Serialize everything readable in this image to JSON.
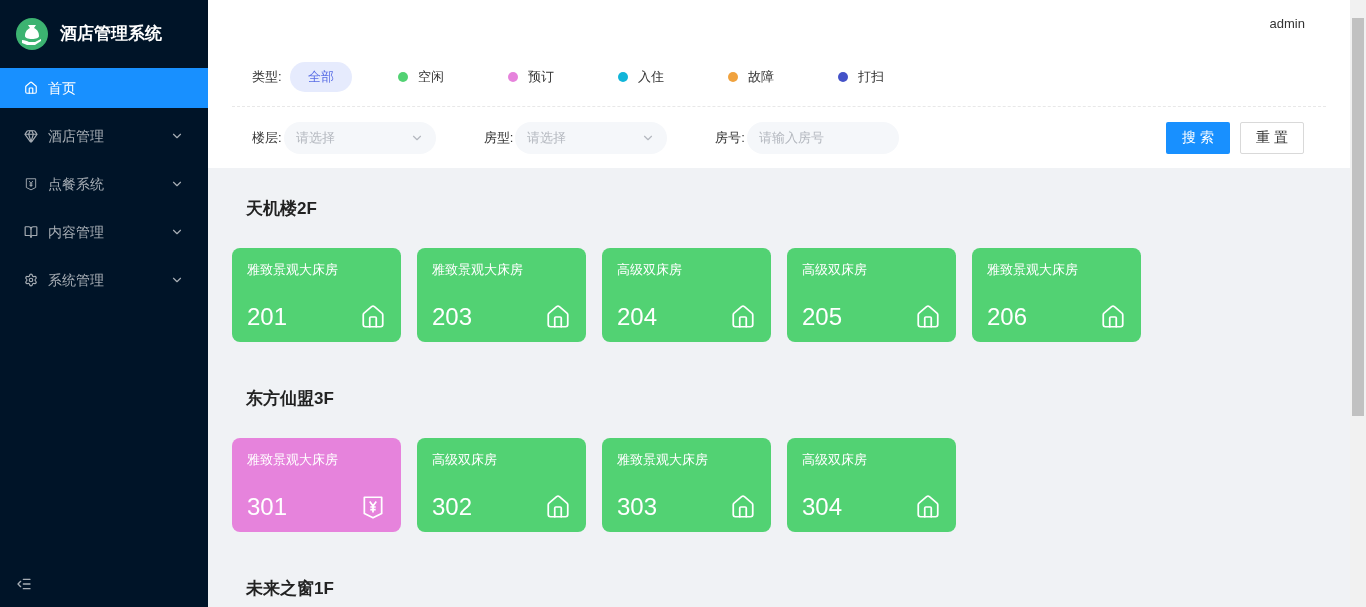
{
  "app": {
    "title": "酒店管理系统"
  },
  "sidebar": {
    "items": [
      {
        "label": "首页",
        "kind": "home",
        "selected": true,
        "expandable": false
      },
      {
        "label": "酒店管理",
        "kind": "diamond",
        "selected": false,
        "expandable": true
      },
      {
        "label": "点餐系统",
        "kind": "order",
        "selected": false,
        "expandable": true
      },
      {
        "label": "内容管理",
        "kind": "book",
        "selected": false,
        "expandable": true
      },
      {
        "label": "系统管理",
        "kind": "gear",
        "selected": false,
        "expandable": true
      }
    ]
  },
  "header": {
    "user": "admin"
  },
  "filters": {
    "type_label": "类型:",
    "types": [
      {
        "label": "全部",
        "selected": true
      },
      {
        "label": "空闲",
        "selected": false,
        "color": "#52d273"
      },
      {
        "label": "预订",
        "selected": false,
        "color": "#e683dc"
      },
      {
        "label": "入住",
        "selected": false,
        "color": "#11b5d9"
      },
      {
        "label": "故障",
        "selected": false,
        "color": "#f0a23e"
      },
      {
        "label": "打扫",
        "selected": false,
        "color": "#4452c8"
      }
    ],
    "fields": [
      {
        "label": "楼层:",
        "kind": "select",
        "placeholder": "请选择"
      },
      {
        "label": "房型:",
        "kind": "select",
        "placeholder": "请选择"
      },
      {
        "label": "房号:",
        "kind": "input",
        "placeholder": "请输入房号"
      }
    ],
    "buttons": [
      {
        "label": "搜 索",
        "kind": "primary"
      },
      {
        "label": "重 置",
        "kind": "default"
      }
    ]
  },
  "floors": [
    {
      "name": "天机楼2F",
      "rooms": [
        {
          "type": "雅致景观大床房",
          "number": "201",
          "kind": "free"
        },
        {
          "type": "雅致景观大床房",
          "number": "203",
          "kind": "free"
        },
        {
          "type": "高级双床房",
          "number": "204",
          "kind": "free"
        },
        {
          "type": "高级双床房",
          "number": "205",
          "kind": "free"
        },
        {
          "type": "雅致景观大床房",
          "number": "206",
          "kind": "free"
        }
      ]
    },
    {
      "name": "东方仙盟3F",
      "rooms": [
        {
          "type": "雅致景观大床房",
          "number": "301",
          "kind": "booked"
        },
        {
          "type": "高级双床房",
          "number": "302",
          "kind": "free"
        },
        {
          "type": "雅致景观大床房",
          "number": "303",
          "kind": "free"
        },
        {
          "type": "高级双床房",
          "number": "304",
          "kind": "free"
        }
      ]
    },
    {
      "name": "未来之窗1F"
    }
  ]
}
